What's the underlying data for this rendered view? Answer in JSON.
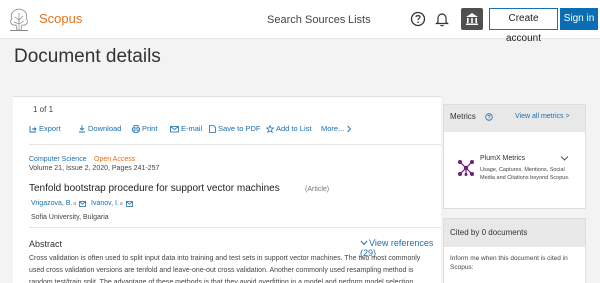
{
  "header": {
    "brand": "Scopus",
    "nav": [
      "Search",
      "Sources",
      "Lists"
    ],
    "create_account": "Create account",
    "sign_in": "Sign in"
  },
  "page_title": "Document details",
  "pager": "1 of 1",
  "actions": [
    "Export",
    "Download",
    "Print",
    "E-mail",
    "Save to PDF",
    "Add to List",
    "More..."
  ],
  "document": {
    "subject": "Computer Science",
    "access": "Open Access",
    "volume": "Volume 21, Issue 2, 2020, Pages 241-257",
    "title": "Tenfold bootstrap procedure for support vector machines",
    "type": "(Article)",
    "authors": [
      {
        "name": "Vrigazova, B.",
        "sup": "a"
      },
      {
        "name": "Ivanov, I.",
        "sup": "a"
      }
    ],
    "affiliation": "Sofia University, Bulgaria"
  },
  "abstract": {
    "heading": "Abstract",
    "view_refs": "View references (29)",
    "text": "Cross validation is often used to split input data into training and test sets in support vector machines. The two most commonly used cross validation versions are tenfold and leave-one-out cross validation. Another commonly used resampling method is random test/train split. The advantage of these methods is that they avoid overfitting in a model and perform model selection."
  },
  "metrics": {
    "title": "Metrics",
    "view_all": "View all metrics >",
    "plumx_title": "PlumX Metrics",
    "plumx_desc": "Usage, Captures, Mentions, Social Media and Citations beyond Scopus."
  },
  "cited": {
    "title": "Cited by 0 documents",
    "desc": "Inform me when this document is cited in Scopus:"
  },
  "colors": {
    "brand": "#e9711c",
    "link": "#1a6fb0",
    "signin_bg": "#0b6db3",
    "plumx": "#6b1f7c"
  },
  "icons": [
    "elsevier-tree-icon",
    "help-icon",
    "bell-icon",
    "institution-icon",
    "export-icon",
    "download-icon",
    "print-icon",
    "email-icon",
    "pdf-icon",
    "add-list-icon",
    "chevron-right-icon",
    "mail-icon",
    "chevron-down-icon",
    "plumx-icon",
    "question-icon"
  ]
}
